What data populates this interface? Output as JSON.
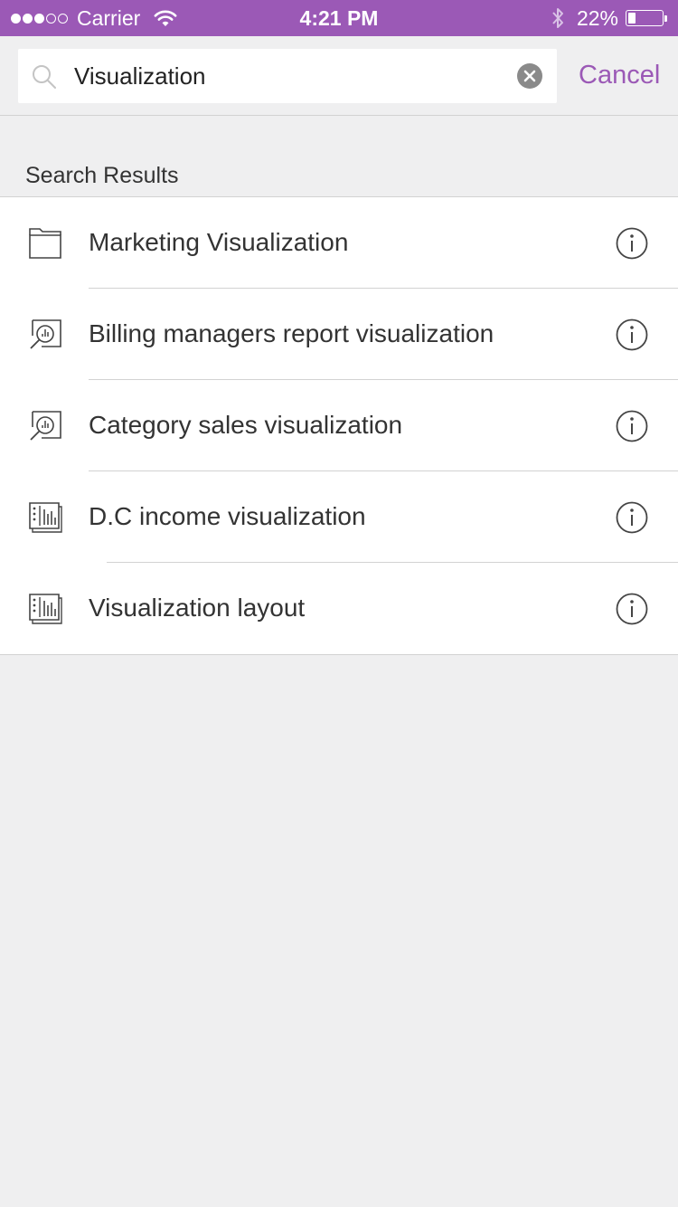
{
  "status_bar": {
    "signal_filled": 3,
    "signal_total": 5,
    "carrier": "Carrier",
    "time": "4:21 PM",
    "battery_percent": "22%",
    "battery_level": 0.22,
    "bluetooth_icon": "bluetooth-icon",
    "wifi_icon": "wifi-icon"
  },
  "search": {
    "value": "Visualization",
    "placeholder": "",
    "search_icon": "search-icon",
    "clear_icon": "clear-icon",
    "cancel_label": "Cancel"
  },
  "section": {
    "title": "Search Results"
  },
  "results": [
    {
      "label": "Marketing Visualization",
      "icon": "folder-icon"
    },
    {
      "label": "Billing managers report visualization",
      "icon": "report-icon"
    },
    {
      "label": "Category sales visualization",
      "icon": "report-icon"
    },
    {
      "label": "D.C income visualization",
      "icon": "dashboard-icon"
    },
    {
      "label": "Visualization layout",
      "icon": "dashboard-icon"
    }
  ],
  "colors": {
    "accent": "#9b59b6",
    "background": "#efeff0",
    "separator": "#d2d2d2",
    "text": "#333333"
  }
}
